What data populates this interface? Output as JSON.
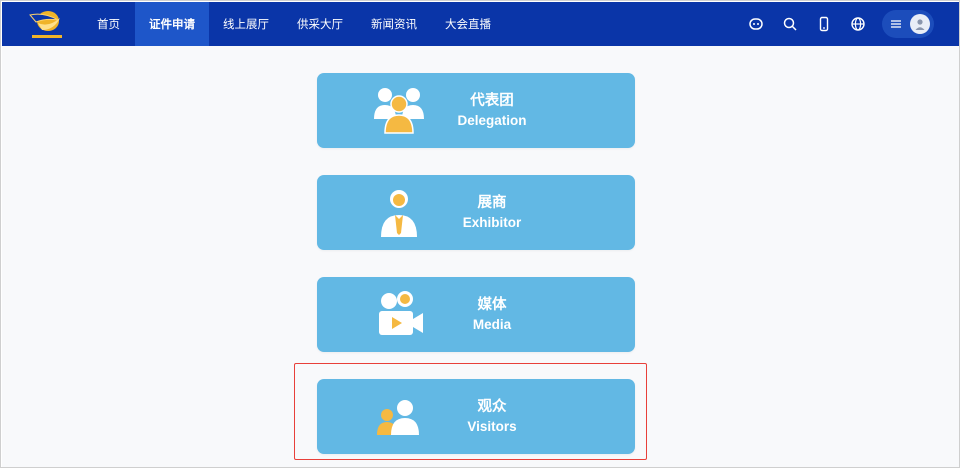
{
  "navbar": {
    "items": [
      {
        "label": "首页",
        "active": false
      },
      {
        "label": "证件申请",
        "active": true
      },
      {
        "label": "线上展厅",
        "active": false
      },
      {
        "label": "供采大厅",
        "active": false
      },
      {
        "label": "新闻资讯",
        "active": false
      },
      {
        "label": "大会直播",
        "active": false
      }
    ],
    "icons": [
      "robot-icon",
      "search-icon",
      "mobile-icon",
      "globe-icon",
      "menu-icon",
      "user-icon"
    ],
    "colors": {
      "background": "#0a35a8",
      "active": "#1e56c9"
    }
  },
  "cards": [
    {
      "cn": "代表团",
      "en": "Delegation",
      "icon": "delegation-group-icon"
    },
    {
      "cn": "展商",
      "en": "Exhibitor",
      "icon": "exhibitor-person-icon"
    },
    {
      "cn": "媒体",
      "en": "Media",
      "icon": "media-camera-icon"
    },
    {
      "cn": "观众",
      "en": "Visitors",
      "icon": "visitors-icon"
    }
  ],
  "colors": {
    "card": "#62b8e4",
    "accent_user": "#f5b942",
    "highlight": "#e8403a"
  }
}
